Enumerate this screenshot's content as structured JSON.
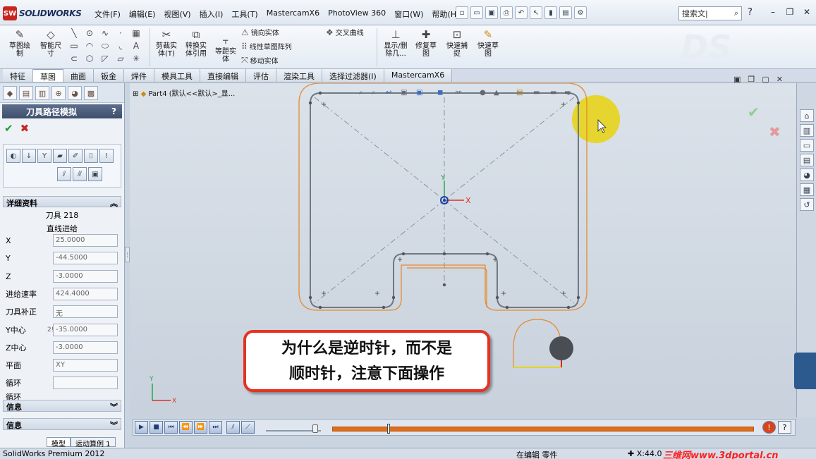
{
  "app": {
    "logo_badge": "SW",
    "logo_text": "SOLIDWORKS"
  },
  "menu": [
    "文件(F)",
    "编辑(E)",
    "视图(V)",
    "插入(I)",
    "工具(T)",
    "MastercamX6",
    "PhotoView 360",
    "窗口(W)",
    "帮助(H)"
  ],
  "search": {
    "placeholder": "搜索文|"
  },
  "ribbon": {
    "sketch_draw": "草图绘\n制",
    "smart_dim": "智能尺\n寸",
    "trim_entities": "剪裁实\n体(T)",
    "convert_entities": "转换实\n体引用",
    "offset_entities": "等距实\n体",
    "mirror_entities": "镜向实体",
    "linear_pattern": "线性草图阵列",
    "move_entities": "移动实体",
    "intersect_curves": "交叉曲线",
    "display_delete": "显示/删\n除几...",
    "repair_sketch": "修复草\n图",
    "quick_snap": "快速捕\n捉",
    "quick_sketch": "快速草\n图"
  },
  "tabs": [
    "特征",
    "草图",
    "曲面",
    "钣金",
    "焊件",
    "模具工具",
    "直接编辑",
    "评估",
    "渲染工具",
    "选择过滤器(I)",
    "MastercamX6"
  ],
  "active_tab": "草图",
  "panel": {
    "title": "刀具路径模拟",
    "help": "?",
    "details_heading": "详细资料",
    "tool_line": "刀具 218",
    "motion_line": "直线进给",
    "fields": [
      {
        "label": "X",
        "value": "25.0000"
      },
      {
        "label": "Y",
        "value": "-44.5000"
      },
      {
        "label": "Z",
        "value": "-3.0000"
      },
      {
        "label": "进给速率",
        "value": "424.4000"
      },
      {
        "label": "刀具补正",
        "value": "无"
      },
      {
        "label": "Y中心",
        "value": "-35.0000"
      },
      {
        "label": "Z中心",
        "value": "-3.0000"
      },
      {
        "label": "平面",
        "value": "XY"
      },
      {
        "label": "循环",
        "value": ""
      },
      {
        "label": "循环",
        "value": ""
      }
    ],
    "yc_prefix": "2!",
    "info_heading_1": "信息",
    "info_heading_2": "信息"
  },
  "tree": {
    "label": "Part4 (默认<<默认>_显..."
  },
  "axis": {
    "x": "X",
    "y": "Y"
  },
  "callout": {
    "line1": "为什么是逆时针，而不是",
    "line2": "顺时针，注意下面操作"
  },
  "model_tabs": [
    "模型",
    "运动算例 1"
  ],
  "status": {
    "product": "SolidWorks Premium 2012",
    "mode": "在编辑 零件",
    "coords": "X:44.0",
    "watermark": "三维网www.3dportal.cn"
  },
  "colors": {
    "accent_red": "#e53222",
    "toolpath_orange": "#e26d16",
    "highlight_yellow": "#e7d41a"
  }
}
